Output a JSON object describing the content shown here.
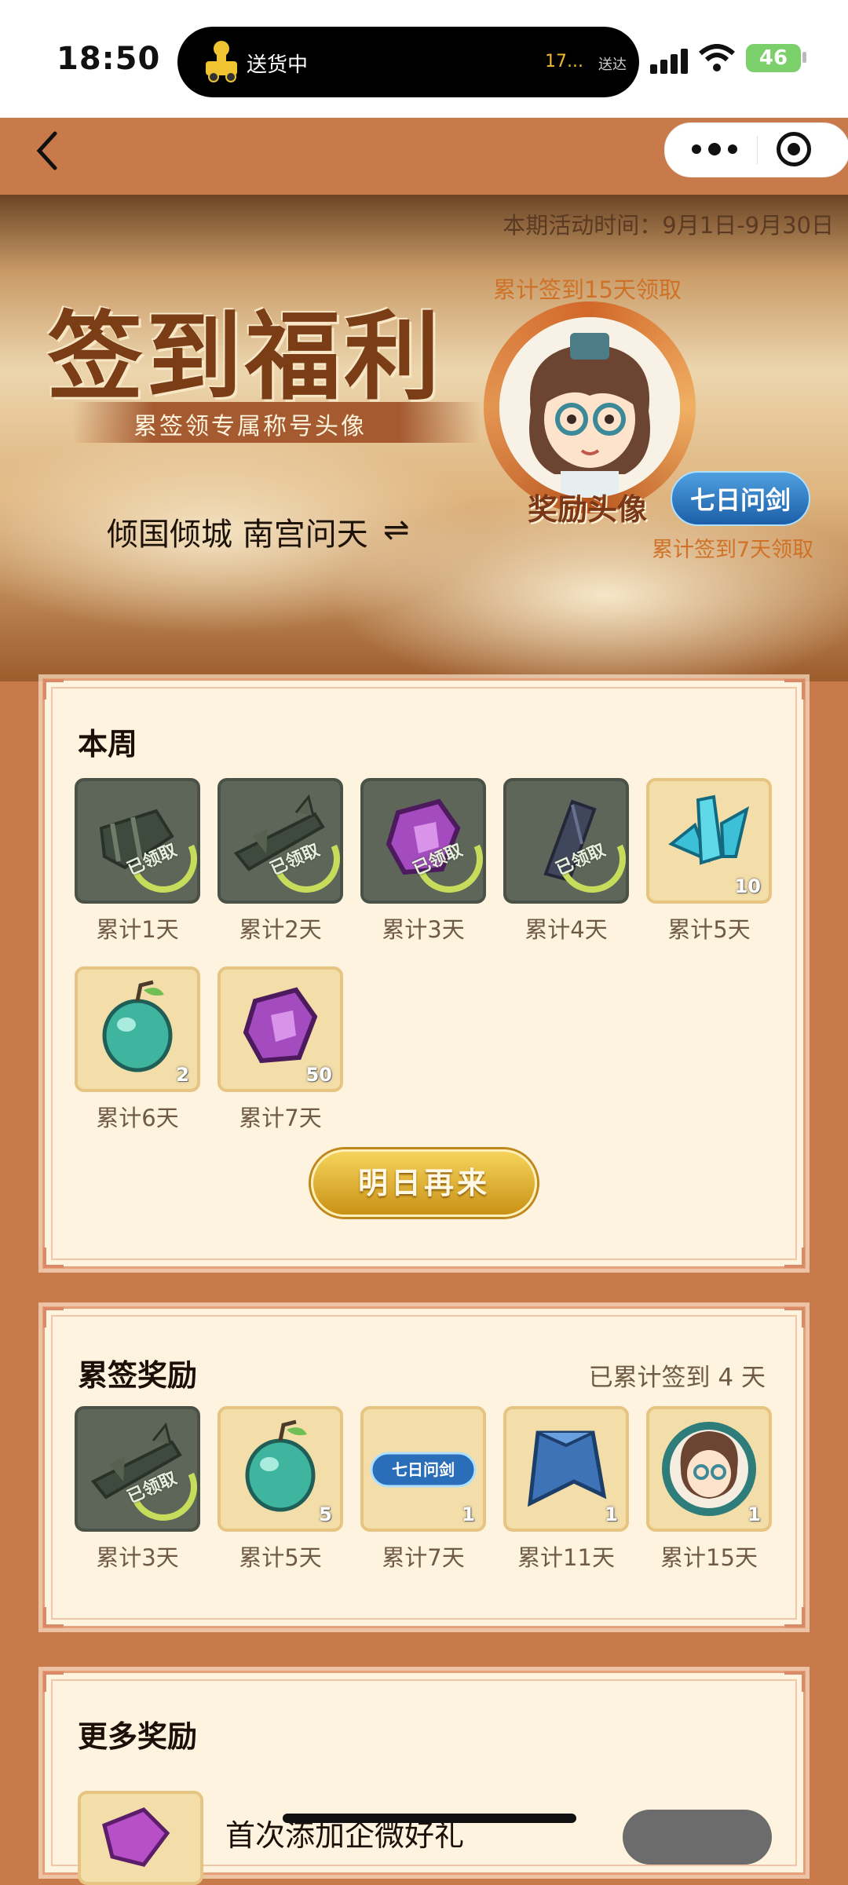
{
  "status_bar": {
    "time": "18:50",
    "live_activity": {
      "label": "送货中",
      "eta": "17...",
      "status": "送达"
    },
    "battery": "46"
  },
  "nav": {
    "back_icon": "chevron-left-icon",
    "more_icon": "more-dots-icon",
    "close_icon": "target-icon"
  },
  "banner": {
    "period": "本期活动时间：9月1日-9月30日",
    "title": "签到福利",
    "subtitle": "累签领专属称号头像",
    "server_character": "倾国倾城 南宫问天",
    "frame_caption": "累计签到15天领取",
    "avatar_label": "奖励头像",
    "title_badge": "七日问剑",
    "badge_caption": "累计签到7天领取"
  },
  "week": {
    "title": "本周",
    "claimed_text": "已领取",
    "days": [
      {
        "label": "累计1天",
        "state": "claimed",
        "item": "blade-relic"
      },
      {
        "label": "累计2天",
        "state": "claimed",
        "item": "broken-sword"
      },
      {
        "label": "累计3天",
        "state": "claimed",
        "item": "purple-gem"
      },
      {
        "label": "累计4天",
        "state": "claimed",
        "item": "stone-shard"
      },
      {
        "label": "累计5天",
        "state": "pending",
        "item": "blue-crystal",
        "qty": "10"
      },
      {
        "label": "累计6天",
        "state": "pending",
        "item": "jade-fruit",
        "qty": "2"
      },
      {
        "label": "累计7天",
        "state": "pending",
        "item": "purple-gem",
        "qty": "50"
      }
    ],
    "button": "明日再来"
  },
  "cumulative": {
    "title": "累签奖励",
    "count": "已累计签到 4 天",
    "claimed_text": "已领取",
    "rewards": [
      {
        "label": "累计3天",
        "state": "claimed",
        "item": "broken-sword"
      },
      {
        "label": "累计5天",
        "state": "pending",
        "item": "jade-fruit",
        "qty": "5"
      },
      {
        "label": "累计7天",
        "state": "pending",
        "item": "title-badge",
        "badge_text": "七日问剑",
        "qty": "1"
      },
      {
        "label": "累计11天",
        "state": "pending",
        "item": "blue-cloak",
        "qty": "1"
      },
      {
        "label": "累计15天",
        "state": "pending",
        "item": "avatar-frame",
        "qty": "1"
      }
    ]
  },
  "more": {
    "title": "更多奖励",
    "item_title": "首次添加企微好礼"
  },
  "colors": {
    "accent": "#c97a4a",
    "panel": "#fdf3df",
    "claimed": "#5d6659",
    "button": "#e2b235"
  }
}
